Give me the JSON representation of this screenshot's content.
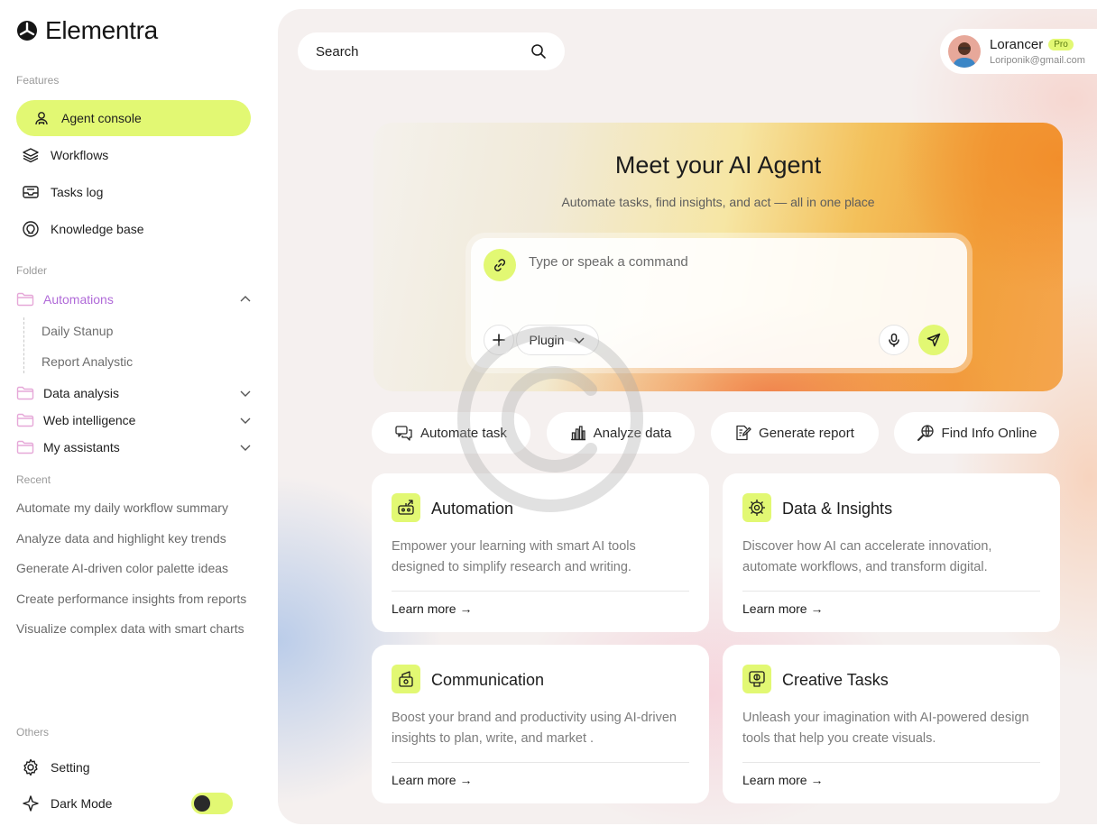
{
  "brand": {
    "name": "Elementra",
    "icon": "brand-logo-icon"
  },
  "sidebar": {
    "features_label": "Features",
    "features": [
      {
        "label": "Agent console",
        "icon": "agent-icon",
        "active": true
      },
      {
        "label": "Workflows",
        "icon": "layers-icon",
        "active": false
      },
      {
        "label": "Tasks log",
        "icon": "inbox-icon",
        "active": false
      },
      {
        "label": "Knowledge base",
        "icon": "bulb-icon",
        "active": false
      }
    ],
    "folder_label": "Folder",
    "folders": [
      {
        "label": "Automations",
        "open": true,
        "children": [
          "Daily Stanup",
          "Report Analystic"
        ]
      },
      {
        "label": "Data analysis",
        "open": false
      },
      {
        "label": "Web intelligence",
        "open": false
      },
      {
        "label": "My assistants",
        "open": false
      }
    ],
    "recent_label": "Recent",
    "recent": [
      "Automate my daily workflow summary",
      "Analyze data and highlight key trends",
      "Generate AI-driven color palette ideas",
      "Create performance insights from reports",
      "Visualize complex data with smart charts"
    ],
    "others_label": "Others",
    "setting_label": "Setting",
    "dark_mode_label": "Dark Mode",
    "dark_mode_on": true
  },
  "header": {
    "search_placeholder": "Search",
    "user": {
      "name": "Lorancer",
      "badge": "Pro",
      "email": "Loriponik@gmail.com"
    }
  },
  "hero": {
    "title": "Meet your AI Agent",
    "subtitle": "Automate tasks, find insights, and act — all in one place",
    "input_placeholder": "Type or speak a command",
    "plugin_label": "Plugin"
  },
  "quick_actions": [
    {
      "label": "Automate task",
      "icon": "chat-icon"
    },
    {
      "label": "Analyze data",
      "icon": "bar-chart-icon"
    },
    {
      "label": "Generate report",
      "icon": "report-icon"
    },
    {
      "label": "Find Info Online",
      "icon": "search-globe-icon"
    }
  ],
  "cards": [
    {
      "title": "Automation",
      "description": "Empower your learning with smart AI tools designed to simplify research and writing.",
      "link": "Learn more →",
      "icon": "robot-icon"
    },
    {
      "title": "Data & Insights",
      "description": "Discover how AI can accelerate innovation, automate workflows, and transform digital.",
      "link": "Learn more →",
      "icon": "chip-icon"
    },
    {
      "title": "Communication",
      "description": "Boost your brand and productivity using AI-driven insights to plan, write, and market .",
      "link": "Learn more →",
      "icon": "megaphone-icon"
    },
    {
      "title": "Creative Tasks",
      "description": "Unleash your imagination with AI-powered design tools that help you create visuals.",
      "link": "Learn more →",
      "icon": "palette-icon"
    }
  ],
  "colors": {
    "accent": "#e2f873",
    "folder_accent": "#b06ad8",
    "text": "#1c1c1c",
    "muted": "#7c7c7c"
  }
}
